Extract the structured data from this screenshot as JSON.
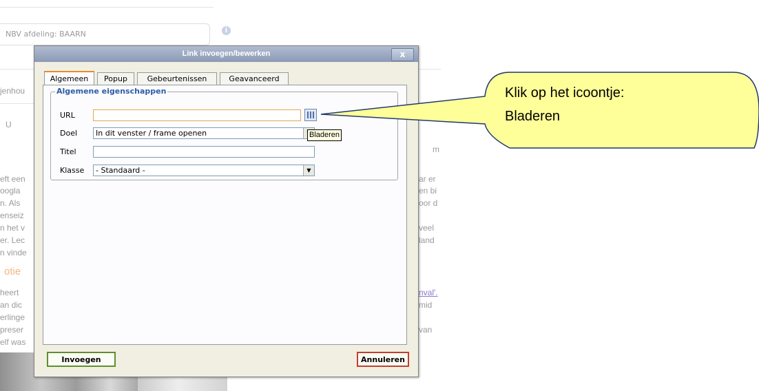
{
  "background": {
    "field_label": "NBV afdeling: BAARN",
    "side_fragments_left": [
      "jenhou",
      "U",
      "eft een",
      "oogla",
      "n. Als",
      "enseiz",
      "n het v",
      "er. Lec",
      "n vinde",
      "heert",
      "an dic",
      "erlinge",
      "preser",
      "elf was"
    ],
    "heading_fragment": "otie",
    "side_fragments_right": [
      "ar er",
      "en bi",
      "oor d",
      "veel",
      "land",
      "nval'.",
      "mid",
      "van"
    ],
    "tail_fragment": "m"
  },
  "dialog": {
    "title": "Link invoegen/bewerken",
    "close_label": "x",
    "tabs": [
      "Algemeen",
      "Popup",
      "Gebeurtenissen",
      "Geavanceerd"
    ],
    "legend": "Algemene eigenschappen",
    "url_label": "URL",
    "url_value": "",
    "doel_label": "Doel",
    "doel_value": "In dit venster / frame openen",
    "titel_label": "Titel",
    "titel_value": "",
    "klasse_label": "Klasse",
    "klasse_value": "- Standaard -",
    "browse_tooltip": "Bladeren",
    "insert_button": "Invoegen",
    "cancel_button": "Annuleren"
  },
  "callout": {
    "line1": "Klik op het icoontje:",
    "line2": "Bladeren",
    "fill_color": "#ffff99"
  }
}
